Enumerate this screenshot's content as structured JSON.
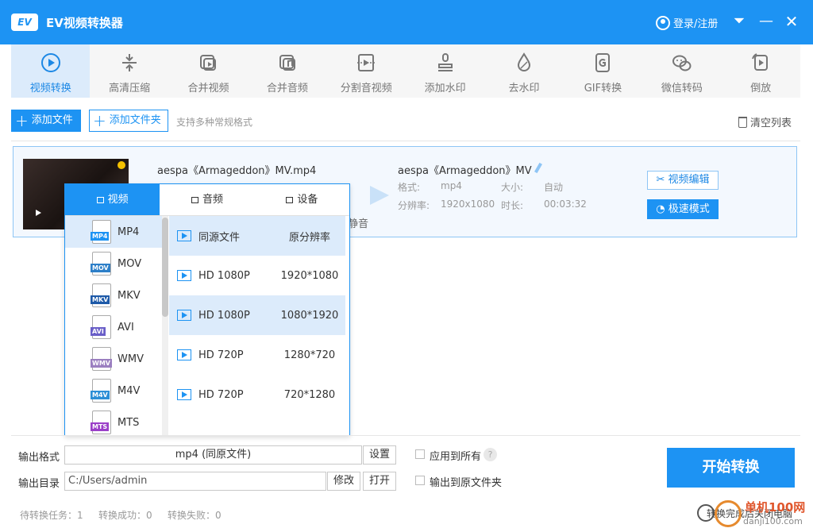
{
  "app": {
    "title": "EV视频转换器",
    "logo_text": "EV",
    "login_label": "登录/注册"
  },
  "toolbar": [
    {
      "label": "视频转换",
      "icon": "video-convert-icon",
      "active": true
    },
    {
      "label": "高清压缩",
      "icon": "compress-icon"
    },
    {
      "label": "合并视频",
      "icon": "merge-video-icon"
    },
    {
      "label": "合并音频",
      "icon": "merge-audio-icon"
    },
    {
      "label": "分割音视频",
      "icon": "split-icon"
    },
    {
      "label": "添加水印",
      "icon": "stamp-icon"
    },
    {
      "label": "去水印",
      "icon": "drop-icon"
    },
    {
      "label": "GIF转换",
      "icon": "gif-icon"
    },
    {
      "label": "微信转码",
      "icon": "wechat-icon"
    },
    {
      "label": "倒放",
      "icon": "reverse-icon"
    }
  ],
  "actions": {
    "add_file": "添加文件",
    "add_folder": "添加文件夹",
    "hint": "支持多种常规格式",
    "clear": "清空列表"
  },
  "file": {
    "source_name": "aespa《Armageddon》MV.mp4",
    "mute_label": "静音",
    "target_name": "aespa《Armageddon》MV",
    "format_label": "格式:",
    "format_value": "mp4",
    "size_label": "大小:",
    "size_value": "自动",
    "resolution_label": "分辨率:",
    "resolution_value": "1920x1080",
    "duration_label": "时长:",
    "duration_value": "00:03:32",
    "edit_button": "视频编辑",
    "speed_button": "极速模式"
  },
  "format_popup": {
    "tabs": [
      {
        "label": "视频",
        "active": true
      },
      {
        "label": "音频"
      },
      {
        "label": "设备"
      }
    ],
    "formats": [
      {
        "name": "MP4",
        "color": "#1d93f3",
        "active": true
      },
      {
        "name": "MOV",
        "color": "#2d7fc8"
      },
      {
        "name": "MKV",
        "color": "#1e5aa8"
      },
      {
        "name": "AVI",
        "color": "#6a5fc8"
      },
      {
        "name": "WMV",
        "color": "#9b7fc0"
      },
      {
        "name": "M4V",
        "color": "#2d8fd6"
      },
      {
        "name": "MTS",
        "color": "#9b3fc8"
      }
    ],
    "resolutions": [
      {
        "name": "同源文件",
        "value": "原分辨率",
        "active": true
      },
      {
        "name": "HD 1080P",
        "value": "1920*1080"
      },
      {
        "name": "HD 1080P",
        "value": "1080*1920",
        "active": true
      },
      {
        "name": "HD 720P",
        "value": "1280*720"
      },
      {
        "name": "HD 720P",
        "value": "720*1280"
      }
    ]
  },
  "output": {
    "format_label": "输出格式",
    "format_value": "mp4 (同原文件)",
    "settings_button": "设置",
    "apply_all_label": "应用到所有",
    "dir_label": "输出目录",
    "dir_value": "C:/Users/admin",
    "modify_button": "修改",
    "open_button": "打开",
    "to_source_label": "输出到原文件夹",
    "start_button": "开始转换"
  },
  "status": {
    "pending": "待转换任务：1",
    "success": "转换成功：0",
    "failed": "转换失败：0",
    "shutdown_label": "转换完成后关闭电脑"
  },
  "watermark": {
    "top": "单机100网",
    "bottom": "danji100.com"
  }
}
